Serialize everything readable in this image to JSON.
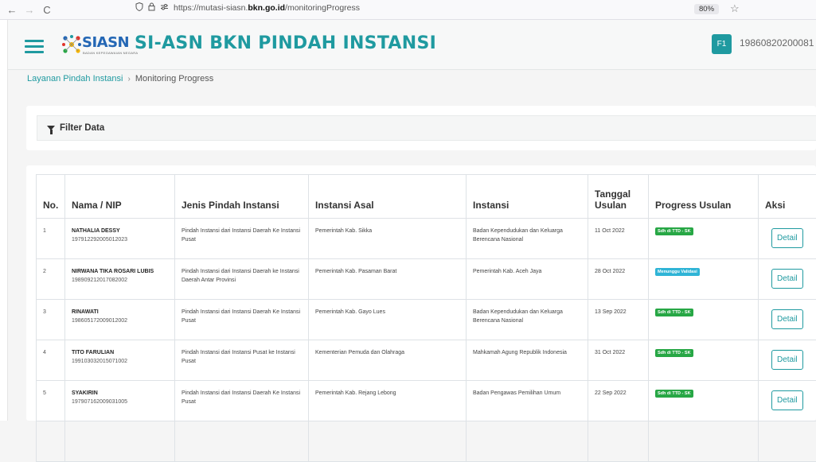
{
  "browser": {
    "back_icon": "←",
    "forward_icon": "→",
    "reload_icon": "C",
    "url_prefix": "https://mutasi-siasn.",
    "url_domain": "bkn.go.id",
    "url_path": "/monitoringProgress",
    "zoom": "80%"
  },
  "header": {
    "logo_main": "SIASN",
    "logo_sub": "BADAN KEPEGAWAIAN NEGARA",
    "title": "SI-ASN BKN PINDAH INSTANSI",
    "avatar": "F1",
    "username": "19860820200081"
  },
  "breadcrumb": {
    "parent": "Layanan Pindah Instansi",
    "separator": "›",
    "current": "Monitoring Progress"
  },
  "filter": {
    "label": "Filter Data"
  },
  "table": {
    "headers": {
      "no": "No.",
      "nama": "Nama / NIP",
      "jenis": "Jenis Pindah Instansi",
      "asal": "Instansi Asal",
      "instansi": "Instansi",
      "tanggal": "Tanggal Usulan",
      "progress": "Progress Usulan",
      "aksi": "Aksi"
    },
    "rows": [
      {
        "no": "1",
        "nama": "NATHALIA DESSY",
        "nip": "197912292005012023",
        "jenis": "Pindah Instansi dari Instansi Daerah Ke Instansi Pusat",
        "asal": "Pemerintah Kab. Sikka",
        "instansi": "Badan Kependudukan dan Keluarga Berencana Nasional",
        "tanggal": "11 Oct 2022",
        "progress": "Sdh di TTD - SK",
        "progress_color": "green",
        "aksi": "Detail"
      },
      {
        "no": "2",
        "nama": "NIRWANA TIKA ROSARI LUBIS",
        "nip": "198909212017082002",
        "jenis": "Pindah Instansi dari Instansi Daerah ke Instansi Daerah Antar Provinsi",
        "asal": "Pemerintah Kab. Pasaman Barat",
        "instansi": "Pemerintah Kab. Aceh Jaya",
        "tanggal": "28 Oct 2022",
        "progress": "Menunggu Validasi",
        "progress_color": "blue",
        "aksi": "Detail"
      },
      {
        "no": "3",
        "nama": "RINAWATI",
        "nip": "198605172009012002",
        "jenis": "Pindah Instansi dari Instansi Daerah Ke Instansi Pusat",
        "asal": "Pemerintah Kab. Gayo Lues",
        "instansi": "Badan Kependudukan dan Keluarga Berencana Nasional",
        "tanggal": "13 Sep 2022",
        "progress": "Sdh di TTD - SK",
        "progress_color": "green",
        "aksi": "Detail"
      },
      {
        "no": "4",
        "nama": "TITO FARULIAN",
        "nip": "199103032015071002",
        "jenis": "Pindah Instansi dari Instansi Pusat ke Instansi Pusat",
        "asal": "Kementerian Pemuda dan Olahraga",
        "instansi": "Mahkamah Agung Republik Indonesia",
        "tanggal": "31 Oct 2022",
        "progress": "Sdh di TTD - SK",
        "progress_color": "green",
        "aksi": "Detail"
      },
      {
        "no": "5",
        "nama": "SYAKIRIN",
        "nip": "197907162009031005",
        "jenis": "Pindah Instansi dari Instansi Daerah Ke Instansi Pusat",
        "asal": "Pemerintah Kab. Rejang Lebong",
        "instansi": "Badan Pengawas Pemilihan Umum",
        "tanggal": "22 Sep 2022",
        "progress": "Sdh di TTD - SK",
        "progress_color": "green",
        "aksi": "Detail"
      }
    ]
  }
}
